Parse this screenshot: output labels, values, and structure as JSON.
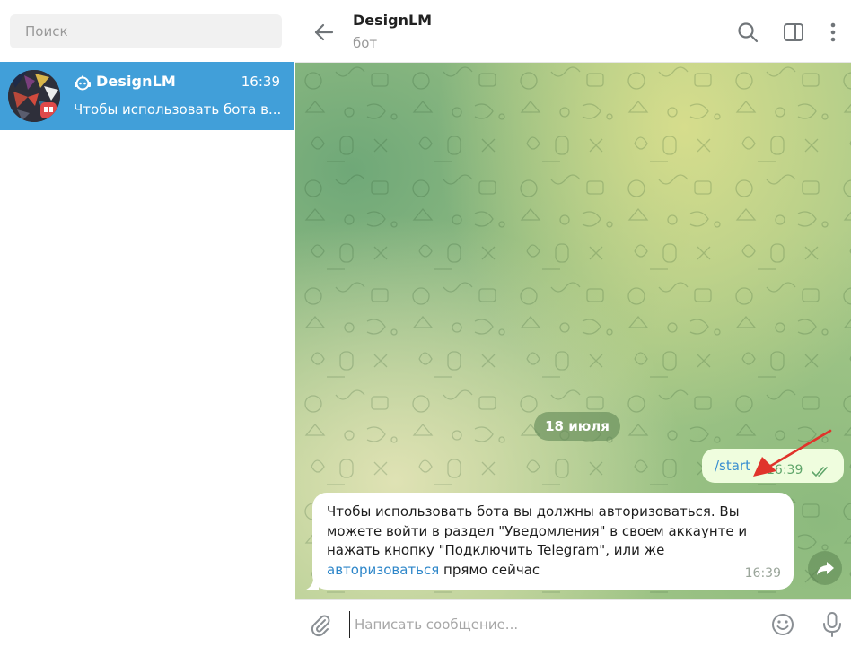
{
  "sidebar": {
    "search_placeholder": "Поиск",
    "chats": [
      {
        "name": "DesignLM",
        "time": "16:39",
        "preview": "Чтобы использовать бота в...",
        "icon": "bot-icon",
        "avatar": "avatar-image"
      }
    ]
  },
  "header": {
    "title": "DesignLM",
    "subtitle": "бот",
    "icons": [
      "back-arrow-icon",
      "search-icon",
      "sidebar-toggle-icon",
      "more-vertical-icon"
    ]
  },
  "messages": {
    "date_separator": "18 июля",
    "outgoing": {
      "text": "/start",
      "time": "16:39",
      "status_icon": "double-check-icon"
    },
    "incoming": {
      "text_part1": "Чтобы использовать бота вы должны авторизоваться. Вы можете войти в раздел \"Уведомления\" в своем аккаунте и нажать кнопку \"Подключить Telegram\", или же ",
      "link_text": "авторизоваться",
      "text_part2": " прямо сейчас",
      "time": "16:39"
    }
  },
  "composer": {
    "placeholder": "Написать сообщение...",
    "icons": [
      "attach-icon",
      "emoji-icon",
      "mic-icon"
    ]
  },
  "colors": {
    "accent": "#419fd9",
    "outgoing_bubble": "#effdde",
    "link": "#2d86c9",
    "annotation_arrow": "#e0342b"
  }
}
